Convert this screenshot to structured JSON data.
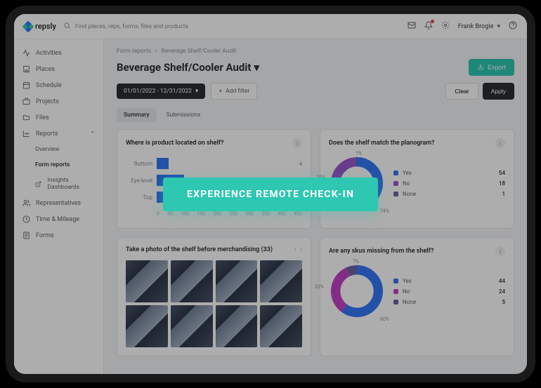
{
  "brand": "repsly",
  "search": {
    "placeholder": "Find places, reps, forms, files and products"
  },
  "user": {
    "name": "Frank Brogie"
  },
  "sidebar": {
    "items": [
      {
        "label": "Activities",
        "icon": "activity"
      },
      {
        "label": "Places",
        "icon": "store"
      },
      {
        "label": "Schedule",
        "icon": "calendar"
      },
      {
        "label": "Projects",
        "icon": "folder"
      },
      {
        "label": "Files",
        "icon": "file"
      },
      {
        "label": "Reports",
        "icon": "chart",
        "expanded": true
      },
      {
        "label": "Overview",
        "sub": true
      },
      {
        "label": "Form reports",
        "sub": true,
        "active": true
      },
      {
        "label": "Insights Dashboards",
        "sub": true,
        "icon": "external"
      },
      {
        "label": "Representatives",
        "icon": "users"
      },
      {
        "label": "Time & Mileage",
        "icon": "clock"
      },
      {
        "label": "Forms",
        "icon": "form"
      }
    ]
  },
  "breadcrumb": {
    "a": "Form reports",
    "b": "Beverage Shelf/Cooler Audit"
  },
  "page": {
    "title": "Beverage Shelf/Cooler Audit"
  },
  "filters": {
    "date_range": "01/01/2022 - 12/31/2022",
    "add_filter": "Add filter",
    "clear": "Clear",
    "apply": "Apply"
  },
  "export_label": "Export",
  "tabs": {
    "summary": "Summary",
    "submissions": "Submissions"
  },
  "cards": {
    "bar": {
      "title": "Where is product located on shelf?",
      "items": [
        {
          "label": "Bottom",
          "value": 4.0
        },
        {
          "label": "Eye-level",
          "value": 9.0
        },
        {
          "label": "Top",
          "value": 17.0
        }
      ],
      "axis": [
        "0",
        "50",
        "100",
        "150",
        "200",
        "250",
        "300",
        "350",
        "400",
        "450"
      ]
    },
    "donut1": {
      "title": "Does the shelf match the planogram?",
      "slices": [
        {
          "name": "Yes",
          "value": 54,
          "pct": 74,
          "color": "#3478f6"
        },
        {
          "name": "No",
          "value": 18,
          "pct": 25,
          "color": "#9b59d0"
        },
        {
          "name": "None",
          "value": 1,
          "pct": 1,
          "color": "#6c63a5"
        }
      ]
    },
    "photos": {
      "title": "Take a photo of the shelf before merchandising (33)"
    },
    "donut2": {
      "title": "Are any skus missing from the shelf?",
      "slices": [
        {
          "name": "Yes",
          "value": 44,
          "pct": 60,
          "color": "#3478f6"
        },
        {
          "name": "No",
          "value": 24,
          "pct": 33,
          "color": "#c542c7"
        },
        {
          "name": "None",
          "value": 5,
          "pct": 7,
          "color": "#6c63a5"
        }
      ]
    }
  },
  "chart_data": [
    {
      "type": "bar",
      "title": "Where is product located on shelf?",
      "categories": [
        "Bottom",
        "Eye-level",
        "Top"
      ],
      "values": [
        4.0,
        9.0,
        17.0
      ],
      "xlabel": "",
      "ylabel": "",
      "xlim": [
        0,
        450
      ]
    },
    {
      "type": "pie",
      "title": "Does the shelf match the planogram?",
      "series": [
        {
          "name": "Yes",
          "value": 54,
          "pct": 74
        },
        {
          "name": "No",
          "value": 18,
          "pct": 25
        },
        {
          "name": "None",
          "value": 1,
          "pct": 1
        }
      ]
    },
    {
      "type": "pie",
      "title": "Are any skus missing from the shelf?",
      "series": [
        {
          "name": "Yes",
          "value": 44,
          "pct": 60
        },
        {
          "name": "No",
          "value": 24,
          "pct": 33
        },
        {
          "name": "None",
          "value": 5,
          "pct": 7
        }
      ]
    }
  ],
  "cta": {
    "label": "EXPERIENCE REMOTE CHECK-IN"
  }
}
